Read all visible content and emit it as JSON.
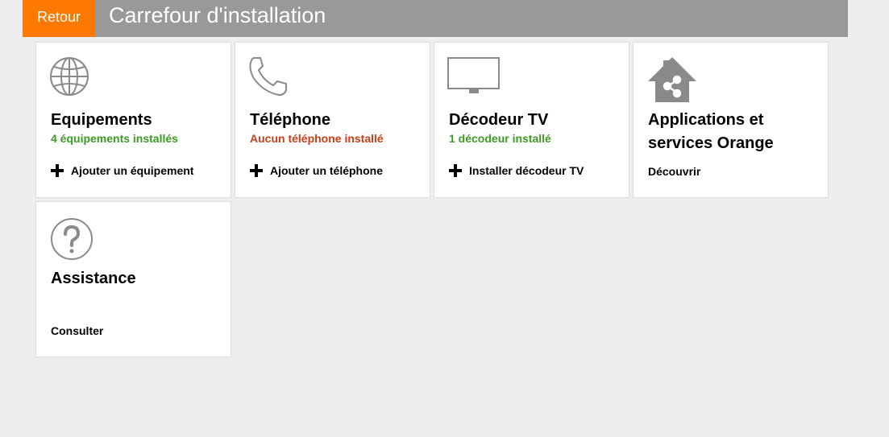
{
  "header": {
    "back_label": "Retour",
    "title": "Carrefour d'installation"
  },
  "tiles": [
    {
      "icon": "globe-icon",
      "title": "Equipements",
      "status": "4 équipements installés",
      "status_color": "#3d9a24",
      "action": "Ajouter un équipement"
    },
    {
      "icon": "phone-icon",
      "title": "Téléphone",
      "status": "Aucun téléphone installé",
      "status_color": "#cd3c14",
      "action": "Ajouter un téléphone"
    },
    {
      "icon": "tv-icon",
      "title": "Décodeur TV",
      "status": "1 décodeur installé",
      "status_color": "#3d9a24",
      "action": "Installer décodeur TV"
    },
    {
      "icon": "home-share-icon",
      "title": "Applications et services Orange",
      "action": "Découvrir"
    },
    {
      "icon": "help-icon",
      "title": "Assistance",
      "action": "Consulter"
    }
  ],
  "colors": {
    "brand_orange": "#ff7900",
    "header_gray": "#999999",
    "background": "#eeeeee",
    "status_ok": "#3d9a24",
    "status_none": "#cd3c14"
  }
}
